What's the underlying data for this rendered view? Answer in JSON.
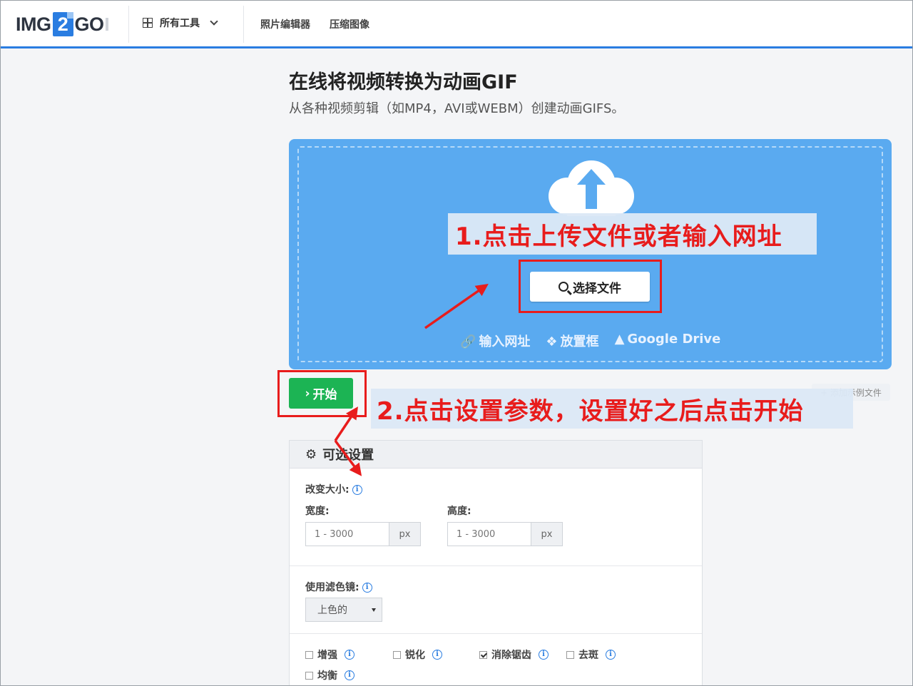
{
  "header": {
    "logo_left": "IMG",
    "logo_mid": "2",
    "logo_right": "GO",
    "tools_label": "所有工具",
    "nav": [
      "照片编辑器",
      "压缩图像"
    ]
  },
  "page": {
    "title": "在线将视频转换为动画GIF",
    "subtitle": "从各种视频剪辑（如MP4，AVI或WEBM）创建动画GIFS。"
  },
  "upload": {
    "choose_label": "选择文件",
    "url_label": "输入网址",
    "dropbox_label": "放置框",
    "gdrive_label": "Google Drive"
  },
  "annotations": {
    "step1": "1.点击上传文件或者输入网址",
    "step2": "2.点击设置参数，设置好之后点击开始"
  },
  "actions": {
    "start_label": "开始",
    "sample_label": "+ 添加示例文件"
  },
  "settings": {
    "header": "可选设置",
    "resize_label": "改变大小:",
    "width_label": "宽度:",
    "height_label": "高度:",
    "width_placeholder": "1 - 3000",
    "height_placeholder": "1 - 3000",
    "unit": "px",
    "filter_label": "使用滤色镜:",
    "filter_value": "上色的",
    "checkboxes": [
      {
        "label": "增强",
        "checked": false
      },
      {
        "label": "锐化",
        "checked": false
      },
      {
        "label": "消除锯齿",
        "checked": true
      },
      {
        "label": "去斑",
        "checked": false
      },
      {
        "label": "均衡",
        "checked": false
      }
    ]
  },
  "colors": {
    "accent": "#2a7de1",
    "upload_bg": "#5aaaf0",
    "start_green": "#1cb454",
    "annotation_red": "#e81c1c"
  }
}
